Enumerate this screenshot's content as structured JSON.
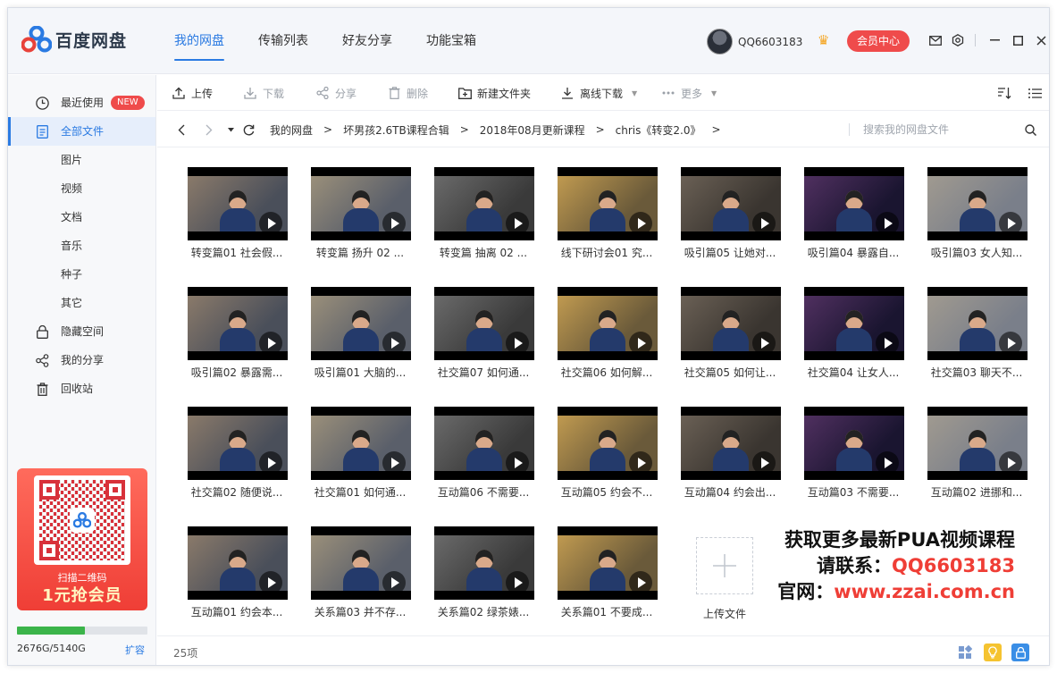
{
  "app": {
    "name": "百度网盘"
  },
  "nav": {
    "tabs": [
      "我的网盘",
      "传输列表",
      "好友分享",
      "功能宝箱"
    ],
    "active": 0
  },
  "user": {
    "name": "QQ6603183",
    "member_button": "会员中心"
  },
  "sidebar": {
    "items": [
      {
        "label": "最近使用",
        "icon": "clock-icon",
        "badge": "NEW"
      },
      {
        "label": "全部文件",
        "icon": "document-icon",
        "active": true
      },
      {
        "label": "图片"
      },
      {
        "label": "视频"
      },
      {
        "label": "文档"
      },
      {
        "label": "音乐"
      },
      {
        "label": "种子"
      },
      {
        "label": "其它"
      },
      {
        "label": "隐藏空间",
        "icon": "lock-icon"
      },
      {
        "label": "我的分享",
        "icon": "share-icon"
      },
      {
        "label": "回收站",
        "icon": "trash-icon"
      }
    ],
    "promo": {
      "scan_text": "扫描二维码",
      "offer_text": "1元抢会员"
    },
    "storage": {
      "text": "2676G/5140G",
      "used_fraction": 0.52,
      "expand_label": "扩容"
    }
  },
  "toolbar": {
    "upload": "上传",
    "download": "下载",
    "share": "分享",
    "delete": "删除",
    "new_folder": "新建文件夹",
    "offline_download": "离线下载",
    "more": "更多"
  },
  "path": {
    "crumbs": [
      "我的网盘",
      "坏男孩2.6TB课程合辑",
      "2018年08月更新课程",
      "chris《转变2.0》"
    ],
    "search_placeholder": "搜索我的网盘文件"
  },
  "files": [
    "转变篇01 社会假...",
    "转变篇 扬升 02 ...",
    "转变篇 抽离 02 ...",
    "线下研讨会01 究...",
    "吸引篇05 让她对...",
    "吸引篇04 暴露自...",
    "吸引篇03 女人知...",
    "吸引篇02 暴露需...",
    "吸引篇01 大脑的...",
    "社交篇07 如何通...",
    "社交篇06 如何解...",
    "社交篇05 如何让...",
    "社交篇04 让女人...",
    "社交篇03 聊天不...",
    "社交篇02 随便说...",
    "社交篇01 如何通...",
    "互动篇06 不需要...",
    "互动篇05 约会不...",
    "互动篇04 约会出...",
    "互动篇03 不需要...",
    "互动篇02 进挪和...",
    "互动篇01 约会本...",
    "关系篇03 并不存...",
    "关系篇02 绿茶婊...",
    "关系篇01 不要成..."
  ],
  "upload_tile": {
    "label": "上传文件"
  },
  "watermark": {
    "line1": "获取更多最新PUA视频课程",
    "line2_prefix": "请联系：",
    "line2_value": "QQ6603183",
    "line3_prefix": "官网：",
    "line3_value": "www.zzai.com.cn"
  },
  "status": {
    "count": "25项"
  },
  "colors": {
    "accent": "#2a7ae2",
    "badge": "#ef4b4b",
    "storage": "#3bb44a"
  }
}
